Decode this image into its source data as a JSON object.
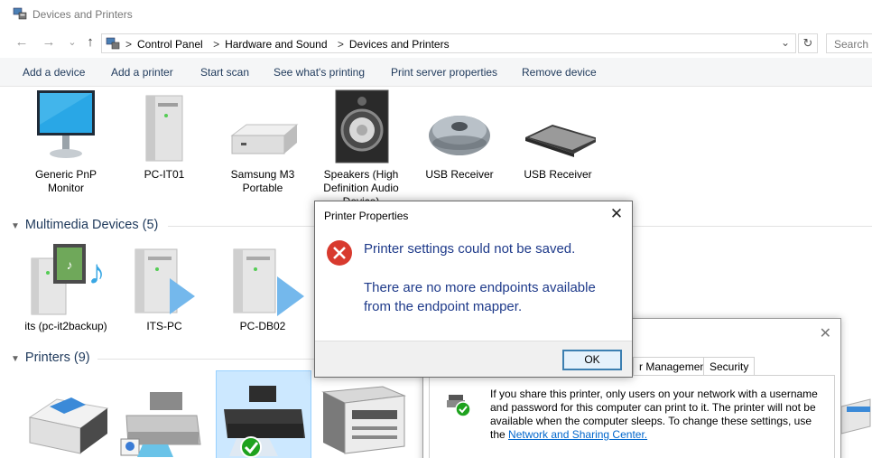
{
  "window": {
    "title": "Devices and Printers",
    "icon": "devices-printers-icon"
  },
  "nav": {
    "back": "←",
    "forward": "→",
    "dropdown": "⌄",
    "up": "↑",
    "refresh": "↻",
    "breadcrumbs": [
      "Control Panel",
      "Hardware and Sound",
      "Devices and Printers"
    ],
    "breadcrumb_separator": ">",
    "search_placeholder": "Search D"
  },
  "commands": [
    "Add a device",
    "Add a printer",
    "Start scan",
    "See what's printing",
    "Print server properties",
    "Remove device"
  ],
  "devices": {
    "items": [
      {
        "label": "Generic PnP Monitor",
        "icon": "monitor-icon"
      },
      {
        "label": "PC-IT01",
        "icon": "tower-pc-icon"
      },
      {
        "label": "Samsung M3 Portable",
        "icon": "external-drive-icon"
      },
      {
        "label": "Speakers (High Definition Audio Device)",
        "icon": "speaker-icon"
      },
      {
        "label": "USB Receiver",
        "icon": "mouse-icon"
      },
      {
        "label": "USB Receiver",
        "icon": "keyboard-icon"
      }
    ]
  },
  "multimedia": {
    "header": "Multimedia Devices (5)",
    "items": [
      {
        "label": "its (pc-it2backup)",
        "icon": "media-server-icon"
      },
      {
        "label": "ITS-PC",
        "icon": "media-pc-icon"
      },
      {
        "label": "PC-DB02",
        "icon": "media-pc-icon"
      }
    ]
  },
  "printers": {
    "header": "Printers (9)"
  },
  "properties_window": {
    "tabs": [
      "Color Management",
      "Security"
    ],
    "tab_partial": "r Management",
    "share_text": "If you share this printer, only users on your network with a username and password for this computer can print to it. The printer will not be available when the computer sleeps. To change these settings, use the",
    "link": "Network and Sharing Center."
  },
  "dialog": {
    "title": "Printer Properties",
    "message": "Printer settings could not be saved.",
    "detail": "There are no more endpoints available from the endpoint mapper.",
    "ok": "OK",
    "close": "✕"
  },
  "colors": {
    "accent_blue": "#1e3a8a",
    "error_red": "#d83a2e",
    "link": "#0066cc",
    "group_header": "#1e395b"
  }
}
